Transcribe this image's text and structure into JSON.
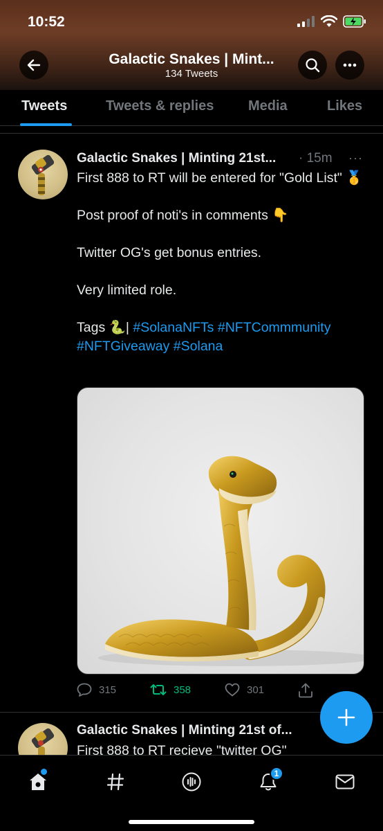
{
  "status_bar": {
    "time": "10:52"
  },
  "header": {
    "title": "Galactic Snakes | Mint...",
    "tweet_count": "134 Tweets"
  },
  "tabs": [
    {
      "label": "Tweets",
      "active": true
    },
    {
      "label": "Tweets & replies",
      "active": false
    },
    {
      "label": "Media",
      "active": false
    },
    {
      "label": "Likes",
      "active": false
    }
  ],
  "tweets": [
    {
      "author": "Galactic Snakes | Minting 21st...",
      "time": "· 15m",
      "more": "···",
      "line1": "First 888 to RT will be entered for \"Gold List\" 🥇",
      "line2": "Post proof of noti's in comments 👇",
      "line3": "Twitter OG's get bonus entries.",
      "line4": "Very limited role.",
      "tags_prefix": "Tags 🐍| ",
      "hashtags": [
        "#SolanaNFTs",
        "#NFTCommmunity",
        "#NFTGiveaway",
        "#Solana"
      ],
      "replies": "315",
      "retweets": "358",
      "likes": "301"
    },
    {
      "author": "Galactic Snakes | Minting 21st of...",
      "line1": "First 888 to RT recieve \"twitter OG\""
    }
  ],
  "notifications_badge": "1",
  "colors": {
    "accent": "#1d9bf0",
    "retweet_green": "#00ba7c",
    "muted": "#71767b"
  },
  "icons": [
    "back-arrow-icon",
    "search-icon",
    "more-icon",
    "reply-icon",
    "retweet-icon",
    "like-icon",
    "share-icon",
    "compose-plus-icon",
    "home-icon",
    "explore-hash-icon",
    "spaces-icon",
    "notifications-bell-icon",
    "messages-mail-icon"
  ]
}
